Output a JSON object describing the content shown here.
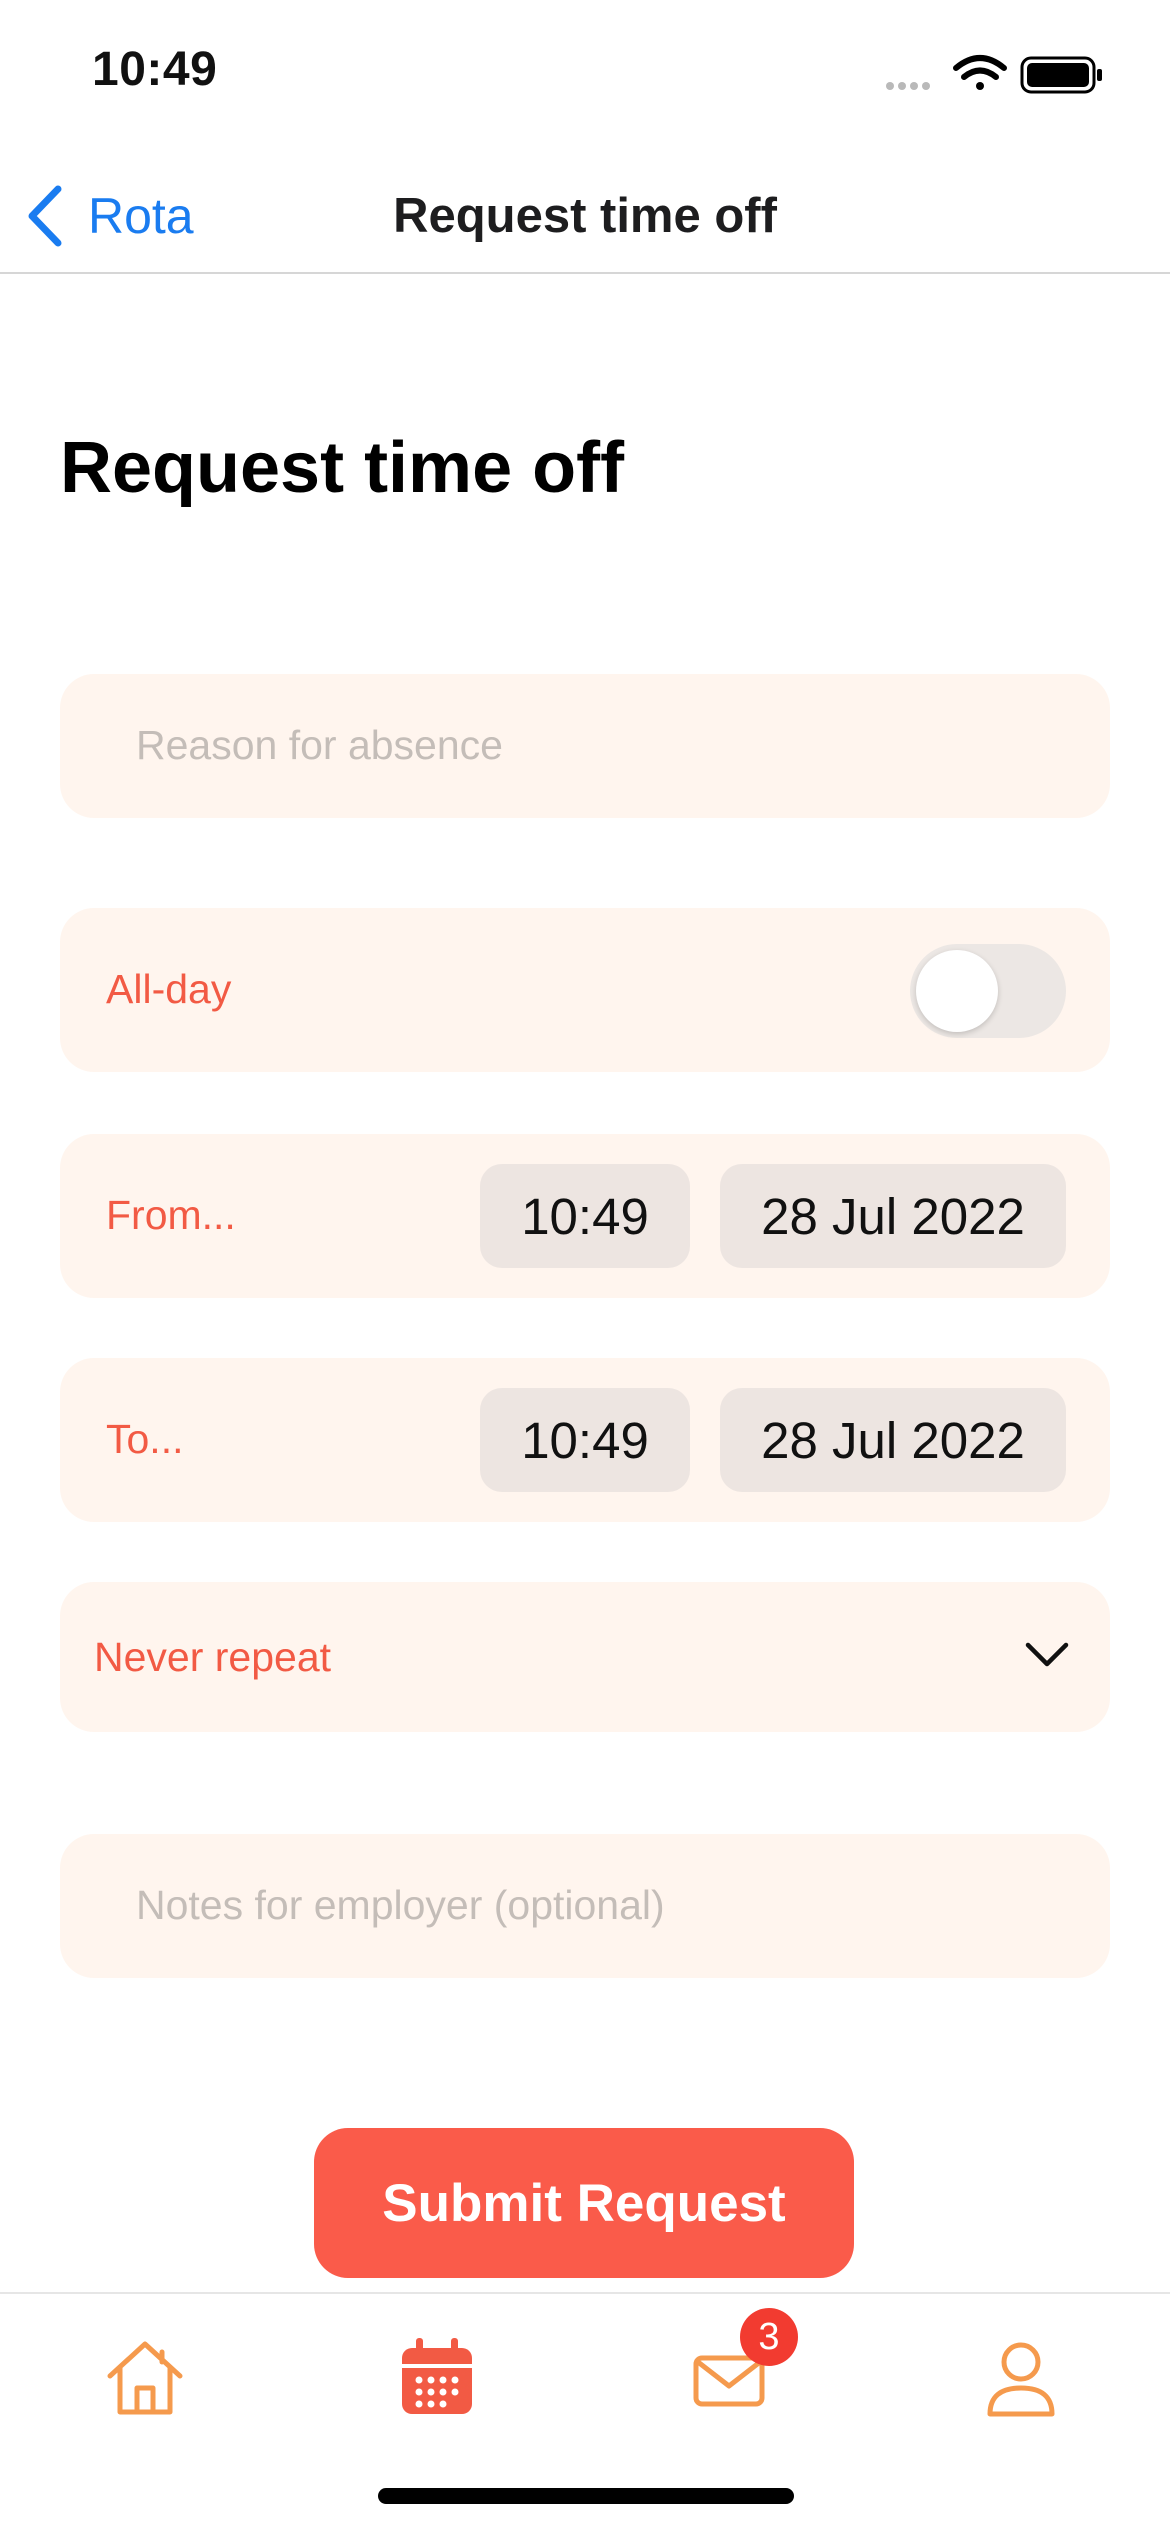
{
  "status_bar": {
    "time": "10:49",
    "icons": [
      "cellular-signal-icon",
      "wifi-icon",
      "battery-icon"
    ]
  },
  "nav": {
    "back_label": "Rota",
    "title": "Request time off"
  },
  "page": {
    "heading": "Request time off"
  },
  "form": {
    "reason_placeholder": "Reason for absence",
    "allday_label": "All-day",
    "allday_on": false,
    "from_label": "From...",
    "from_time": "10:49",
    "from_date": "28 Jul 2022",
    "to_label": "To...",
    "to_time": "10:49",
    "to_date": "28 Jul 2022",
    "repeat_value": "Never repeat",
    "notes_placeholder": "Notes for employer (optional)"
  },
  "submit_label": "Submit Request",
  "tabbar": {
    "tabs": [
      {
        "icon": "home-icon",
        "active": false
      },
      {
        "icon": "calendar-icon",
        "active": true
      },
      {
        "icon": "mail-icon",
        "active": false
      },
      {
        "icon": "user-icon",
        "active": false
      }
    ],
    "mail_badge": "3"
  },
  "colors": {
    "accent": "#fa5b4a",
    "accent_text": "#f25a44",
    "link": "#1a7cf0",
    "card_bg": "#fff5ee",
    "pill_bg": "#ede5e1",
    "tab_icon": "#f59a4d",
    "badge": "#f23b30"
  }
}
